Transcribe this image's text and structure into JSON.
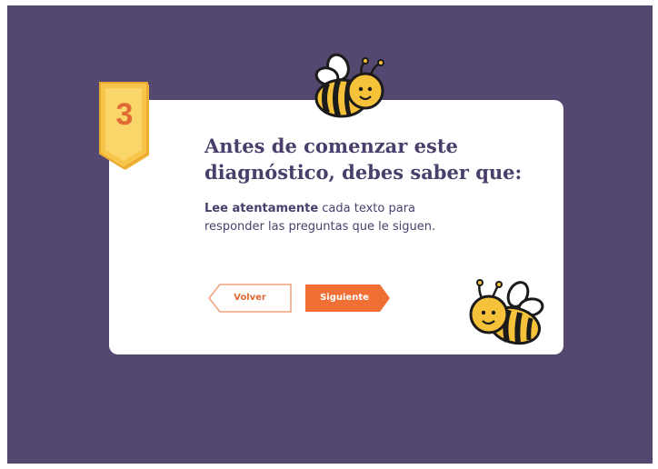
{
  "step": {
    "number": "3"
  },
  "heading": {
    "line1": "Antes de comenzar este",
    "line2": "diagnóstico, debes saber que:"
  },
  "instruction": {
    "bold": "Lee atentamente",
    "rest": "cada texto para responder las preguntas que le siguen."
  },
  "buttons": {
    "back_label": "Volver",
    "next_label": "Siguiente"
  },
  "icons": {
    "badge": "bookmark-ribbon-icon",
    "mascot": "bee-icon"
  },
  "colors": {
    "background": "#544770",
    "card": "#ffffff",
    "accent": "#f06f35",
    "text": "#4a3f6b",
    "badge": "#f6c54a"
  }
}
